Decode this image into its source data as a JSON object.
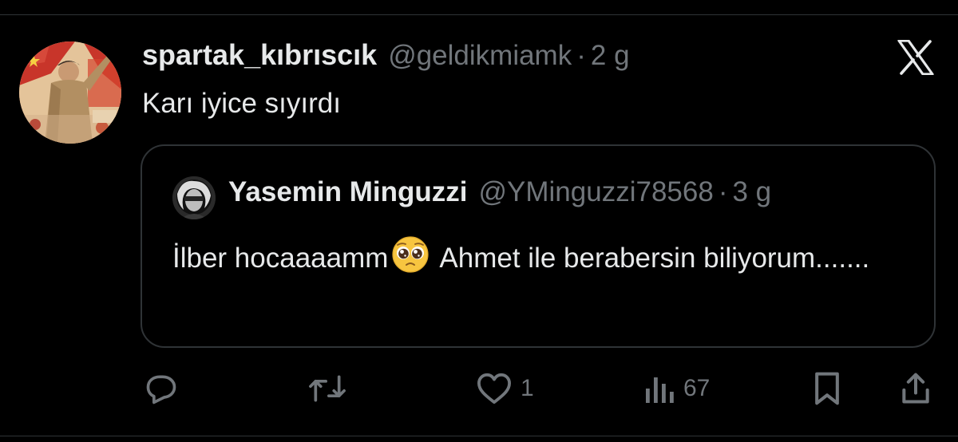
{
  "tweet": {
    "display_name": "spartak_kıbrıscık",
    "handle": "@geldikmiamk",
    "separator": "·",
    "time": "2 g",
    "text": "Karı iyice sıyırdı",
    "avatar_icon": "propaganda-poster-avatar"
  },
  "quote": {
    "display_name": "Yasemin Minguzzi",
    "handle": "@YMinguzzi78568",
    "separator": "·",
    "time": "3 g",
    "text_before_emoji": "İlber hocaaaamm",
    "emoji": "pleading-face-emoji",
    "text_after_emoji": "Ahmet ile berabersin biliyorum.......",
    "avatar_icon": "user-avatar"
  },
  "actions": {
    "reply_icon": "reply-icon",
    "retweet_icon": "retweet-icon",
    "like_icon": "heart-icon",
    "like_count": "1",
    "views_icon": "bar-chart-icon",
    "views_count": "67",
    "bookmark_icon": "bookmark-icon",
    "share_icon": "share-icon"
  },
  "brand": {
    "logo": "x-logo",
    "background": "#000000",
    "text_color": "#e7e9ea",
    "muted_color": "#71767b",
    "border_color": "#2f3336"
  }
}
